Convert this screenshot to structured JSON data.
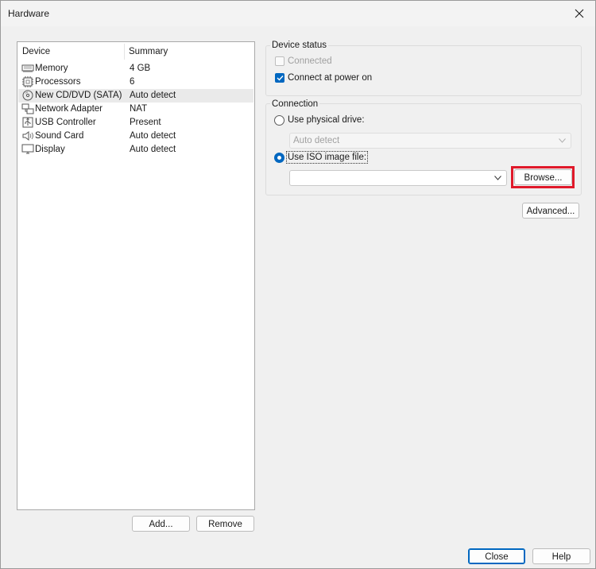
{
  "window": {
    "title": "Hardware"
  },
  "device_list": {
    "columns": [
      "Device",
      "Summary"
    ],
    "rows": [
      {
        "icon": "memory-icon",
        "name": "Memory",
        "summary": "4 GB"
      },
      {
        "icon": "processor-icon",
        "name": "Processors",
        "summary": "6"
      },
      {
        "icon": "cd-dvd-icon",
        "name": "New CD/DVD (SATA)",
        "summary": "Auto detect",
        "selected": true
      },
      {
        "icon": "network-adapter-icon",
        "name": "Network Adapter",
        "summary": "NAT"
      },
      {
        "icon": "usb-controller-icon",
        "name": "USB Controller",
        "summary": "Present"
      },
      {
        "icon": "sound-card-icon",
        "name": "Sound Card",
        "summary": "Auto detect"
      },
      {
        "icon": "display-icon",
        "name": "Display",
        "summary": "Auto detect"
      }
    ]
  },
  "buttons": {
    "add": "Add...",
    "remove": "Remove",
    "browse": "Browse...",
    "advanced": "Advanced...",
    "close": "Close",
    "help": "Help"
  },
  "device_status": {
    "label": "Device status",
    "connected": {
      "label": "Connected",
      "checked": false,
      "disabled": true
    },
    "connect_at_power_on": {
      "label": "Connect at power on",
      "checked": true
    }
  },
  "connection": {
    "label": "Connection",
    "physical_drive": {
      "label": "Use physical drive:",
      "selected": false
    },
    "physical_drive_value": "Auto detect",
    "iso_image": {
      "label": "Use ISO image file:",
      "selected": true
    },
    "iso_path": ""
  },
  "colors": {
    "accent": "#0067c0",
    "highlight": "#e0192a"
  }
}
